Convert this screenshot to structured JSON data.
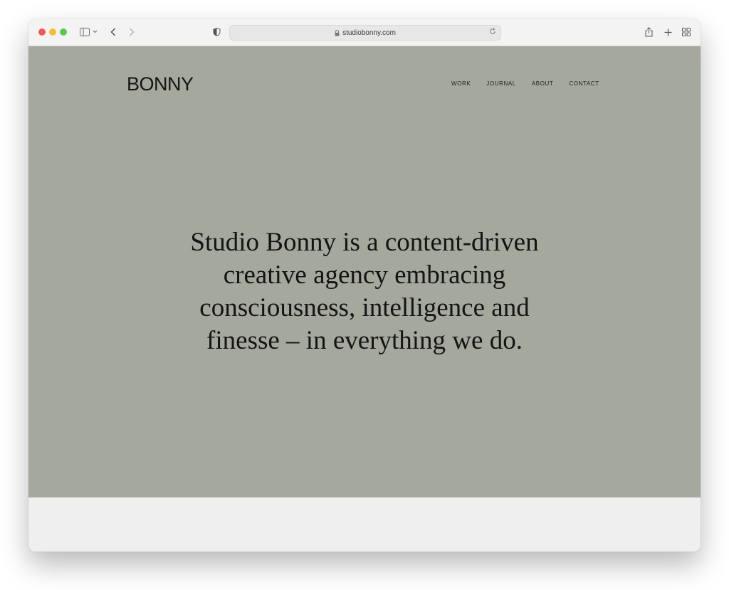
{
  "browser": {
    "url": "studiobonny.com",
    "icons": {
      "sidebar": "sidebar-icon",
      "back": "chevron-left-icon",
      "forward": "chevron-right-icon",
      "privacy": "shield-icon",
      "lock": "lock-icon",
      "reload": "reload-icon",
      "share": "share-icon",
      "new_tab": "plus-icon",
      "tabs": "tab-overview-icon"
    }
  },
  "site": {
    "logo": "BONNY",
    "nav": [
      {
        "label": "WORK"
      },
      {
        "label": "JOURNAL"
      },
      {
        "label": "ABOUT"
      },
      {
        "label": "CONTACT"
      }
    ],
    "hero_lines": [
      "Studio Bonny is a content-driven",
      "creative agency embracing",
      "consciousness, intelligence and",
      "finesse – in everything we do."
    ]
  },
  "colors": {
    "page_background": "#a5a89d",
    "text": "#141414",
    "below_fold": "#efefef"
  }
}
